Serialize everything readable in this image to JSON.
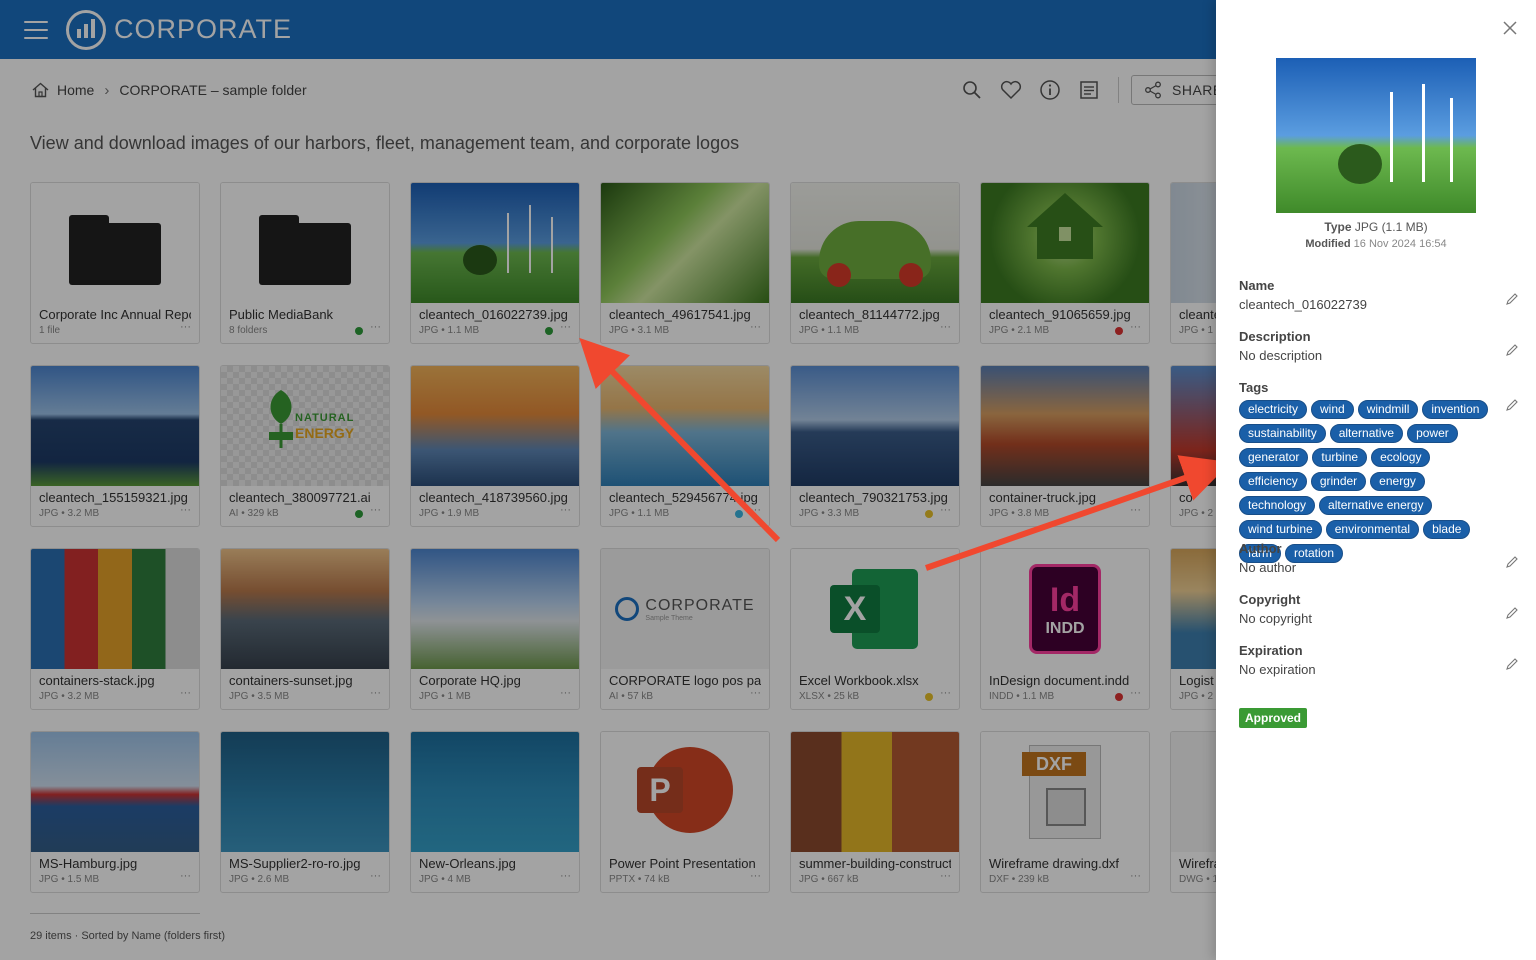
{
  "header": {
    "brand": "CORPORATE"
  },
  "breadcrumb": {
    "home": "Home",
    "folder": "CORPORATE – sample folder"
  },
  "toolbar": {
    "share_label": "SHARE"
  },
  "intro": "View and download images of our harbors, fleet, management team, and corporate logos",
  "footer": {
    "count": "29 items · Sorted by Name (folders first)"
  },
  "items": [
    {
      "name": "Corporate Inc Annual Report",
      "meta": "1 file",
      "status": null
    },
    {
      "name": "Public MediaBank",
      "meta": "8 folders",
      "status": "#2e9b3a"
    },
    {
      "name": "cleantech_016022739.jpg",
      "meta": "JPG • 1.1 MB",
      "status": "#2e9b3a"
    },
    {
      "name": "cleantech_49617541.jpg",
      "meta": "JPG • 3.1 MB",
      "status": null
    },
    {
      "name": "cleantech_81144772.jpg",
      "meta": "JPG • 1.1 MB",
      "status": null
    },
    {
      "name": "cleantech_91065659.jpg",
      "meta": "JPG • 2.1 MB",
      "status": "#d33"
    },
    {
      "name": "cleantech",
      "meta": "JPG • 1",
      "status": null
    },
    {
      "name": "cleantech_155159321.jpg",
      "meta": "JPG • 3.2 MB",
      "status": null
    },
    {
      "name": "cleantech_380097721.ai",
      "meta": "AI • 329 kB",
      "status": "#2e9b3a"
    },
    {
      "name": "cleantech_418739560.jpg",
      "meta": "JPG • 1.9 MB",
      "status": null
    },
    {
      "name": "cleantech_529456774.jpg",
      "meta": "JPG • 1.1 MB",
      "status": "#3ab4e0"
    },
    {
      "name": "cleantech_790321753.jpg",
      "meta": "JPG • 3.3 MB",
      "status": "#e8c12a"
    },
    {
      "name": "container-truck.jpg",
      "meta": "JPG • 3.8 MB",
      "status": null
    },
    {
      "name": "co",
      "meta": "JPG • 2",
      "status": null
    },
    {
      "name": "containers-stack.jpg",
      "meta": "JPG • 3.2 MB",
      "status": null
    },
    {
      "name": "containers-sunset.jpg",
      "meta": "JPG • 3.5 MB",
      "status": null
    },
    {
      "name": "Corporate HQ.jpg",
      "meta": "JPG • 1 MB",
      "status": null
    },
    {
      "name": "CORPORATE logo pos pay",
      "meta": "AI • 57 kB",
      "status": null
    },
    {
      "name": "Excel Workbook.xlsx",
      "meta": "XLSX • 25 kB",
      "status": "#e8c12a"
    },
    {
      "name": "InDesign document.indd",
      "meta": "INDD • 1.1 MB",
      "status": "#d33"
    },
    {
      "name": "Logist",
      "meta": "JPG • 2",
      "status": null
    },
    {
      "name": "MS-Hamburg.jpg",
      "meta": "JPG • 1.5 MB",
      "status": null
    },
    {
      "name": "MS-Supplier2-ro-ro.jpg",
      "meta": "JPG • 2.6 MB",
      "status": null
    },
    {
      "name": "New-Orleans.jpg",
      "meta": "JPG • 4 MB",
      "status": null
    },
    {
      "name": "Power Point Presentation",
      "meta": "PPTX • 74 kB",
      "status": null
    },
    {
      "name": "summer-building-construction",
      "meta": "JPG • 667 kB",
      "status": null
    },
    {
      "name": "Wireframe drawing.dxf",
      "meta": "DXF • 239 kB",
      "status": null
    },
    {
      "name": "Wirefra",
      "meta": "DWG • 1",
      "status": null
    }
  ],
  "thumb_labels": {
    "natural_energy_1": "NATURAL",
    "natural_energy_2": "ENERGY",
    "corporate_logo": "CORPORATE",
    "corporate_logo_sub": "Sample Theme",
    "excel_letter": "X",
    "indd_letters": "Id",
    "indd_text": "INDD",
    "ppt_letter": "P",
    "dxf_text": "DXF"
  },
  "details": {
    "type_label": "Type",
    "type_value": "JPG (1.1 MB)",
    "modified_label": "Modified",
    "modified_value": "16 Nov 2024 16:54",
    "name_label": "Name",
    "name_value": "cleantech_016022739",
    "description_label": "Description",
    "description_value": "No description",
    "tags_label": "Tags",
    "tags": [
      "electricity",
      "wind",
      "windmill",
      "invention",
      "sustainability",
      "alternative",
      "power",
      "generator",
      "turbine",
      "ecology",
      "efficiency",
      "grinder",
      "energy",
      "technology",
      "alternative energy",
      "wind turbine",
      "environmental",
      "blade",
      "farm",
      "rotation"
    ],
    "author_label": "Author",
    "author_value": "No author",
    "copyright_label": "Copyright",
    "copyright_value": "No copyright",
    "expiration_label": "Expiration",
    "expiration_value": "No expiration",
    "status_badge": "Approved"
  },
  "colors": {
    "brand": "#1c6fc0",
    "tag": "#1a5fa8",
    "approved": "#3a9a34",
    "arrow": "#f0482f"
  }
}
